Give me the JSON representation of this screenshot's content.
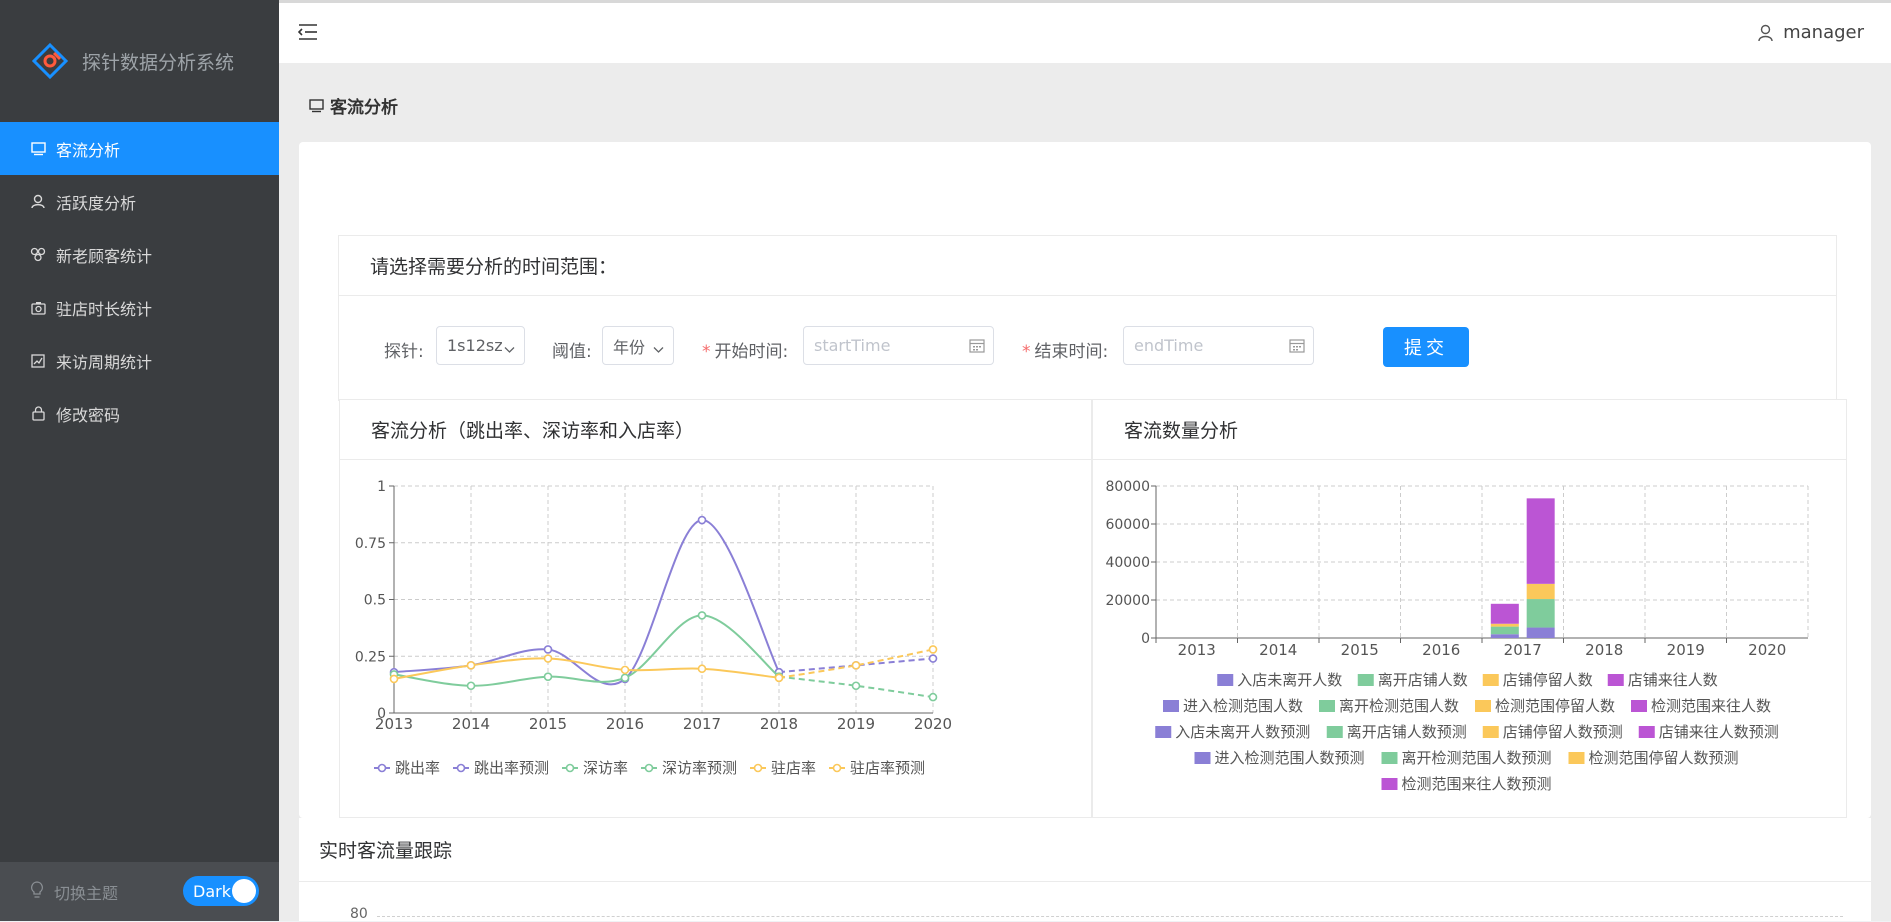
{
  "app": {
    "title": "探针数据分析系统"
  },
  "sidebar": {
    "items": [
      {
        "label": "客流分析",
        "icon": "monitor-icon",
        "active": true
      },
      {
        "label": "活跃度分析",
        "icon": "user-icon",
        "active": false
      },
      {
        "label": "新老顾客统计",
        "icon": "cluster-icon",
        "active": false
      },
      {
        "label": "驻店时长统计",
        "icon": "camera-icon",
        "active": false
      },
      {
        "label": "来访周期统计",
        "icon": "chart-icon",
        "active": false
      },
      {
        "label": "修改密码",
        "icon": "lock-icon",
        "active": false
      }
    ],
    "theme_label": "切换主题",
    "theme_switch": "Dark"
  },
  "header": {
    "username": "manager"
  },
  "breadcrumb": {
    "label": "客流分析"
  },
  "filter": {
    "title": "请选择需要分析的时间范围：",
    "probe_label": "探针:",
    "probe_value": "1s12sz",
    "threshold_label": "阈值:",
    "threshold_value": "年份",
    "start_label": "开始时间:",
    "start_placeholder": "startTime",
    "end_label": "结束时间:",
    "end_placeholder": "endTime",
    "submit_label": "提交",
    "required_mark": "*"
  },
  "colors": {
    "accent": "#1890ff",
    "purple": "#8a7fd6",
    "green": "#7fcc9c",
    "yellow": "#fbc85a",
    "magenta": "#bb55d4"
  },
  "chart_rates_title": "客流分析（跳出率、深访率和入店率）",
  "chart_counts_title": "客流数量分析",
  "realtime_title": "实时客流量跟踪",
  "realtime_axis_top": "80",
  "chart_data": [
    {
      "type": "line",
      "title": "客流分析（跳出率、深访率和入店率）",
      "categories": [
        "2013",
        "2014",
        "2015",
        "2016",
        "2017",
        "2018",
        "2019",
        "2020"
      ],
      "ylim": [
        0,
        1
      ],
      "yticks": [
        "0",
        "0.25",
        "0.5",
        "0.75",
        "1"
      ],
      "grid": true,
      "legend_position": "bottom",
      "series": [
        {
          "name": "跳出率",
          "color": "#8a7fd6",
          "style": "solid",
          "values": [
            0.18,
            0.21,
            0.28,
            0.15,
            0.85,
            0.18,
            null,
            null
          ]
        },
        {
          "name": "跳出率预测",
          "color": "#8a7fd6",
          "style": "dashed",
          "values": [
            null,
            null,
            null,
            null,
            null,
            0.18,
            0.21,
            0.24
          ]
        },
        {
          "name": "深访率",
          "color": "#7fcc9c",
          "style": "solid",
          "values": [
            0.17,
            0.12,
            0.16,
            0.155,
            0.43,
            0.16,
            null,
            null
          ]
        },
        {
          "name": "深访率预测",
          "color": "#7fcc9c",
          "style": "dashed",
          "values": [
            null,
            null,
            null,
            null,
            null,
            0.16,
            0.12,
            0.07
          ]
        },
        {
          "name": "驻店率",
          "color": "#fbc85a",
          "style": "solid",
          "values": [
            0.15,
            0.21,
            0.24,
            0.19,
            0.195,
            0.155,
            null,
            null
          ]
        },
        {
          "name": "驻店率预测",
          "color": "#fbc85a",
          "style": "dashed",
          "values": [
            null,
            null,
            null,
            null,
            null,
            0.155,
            0.21,
            0.28
          ]
        }
      ]
    },
    {
      "type": "bar",
      "stacked": true,
      "title": "客流数量分析",
      "categories": [
        "2013",
        "2014",
        "2015",
        "2016",
        "2017",
        "2018",
        "2019",
        "2020"
      ],
      "ylim": [
        0,
        80000
      ],
      "yticks": [
        "0",
        "20000",
        "40000",
        "60000",
        "80000"
      ],
      "grid": true,
      "legend_position": "bottom",
      "series": [
        {
          "name": "入店未离开人数",
          "color": "#8a7fd6",
          "stack": "store",
          "values": [
            0,
            0,
            0,
            0,
            null,
            0,
            0,
            0
          ]
        },
        {
          "name": "离开店铺人数",
          "color": "#7fcc9c",
          "stack": "store",
          "values": [
            0,
            0,
            0,
            0,
            null,
            0,
            0,
            0
          ]
        },
        {
          "name": "店铺停留人数",
          "color": "#fbc85a",
          "stack": "store",
          "values": [
            0,
            0,
            0,
            0,
            null,
            0,
            0,
            0
          ]
        },
        {
          "name": "店铺来往人数",
          "color": "#bb55d4",
          "stack": "store",
          "values": [
            0,
            0,
            0,
            0,
            null,
            0,
            0,
            0
          ]
        },
        {
          "name": "进入检测范围人数",
          "color": "#8a7fd6",
          "stack": "range",
          "values": [
            0,
            0,
            0,
            0,
            null,
            0,
            0,
            0
          ]
        },
        {
          "name": "离开检测范围人数",
          "color": "#7fcc9c",
          "stack": "range",
          "values": [
            0,
            0,
            0,
            0,
            null,
            0,
            0,
            0
          ]
        },
        {
          "name": "检测范围停留人数",
          "color": "#fbc85a",
          "stack": "range",
          "values": [
            0,
            0,
            0,
            0,
            null,
            0,
            0,
            0
          ]
        },
        {
          "name": "检测范围来往人数",
          "color": "#bb55d4",
          "stack": "range",
          "values": [
            0,
            0,
            0,
            0,
            null,
            0,
            0,
            0
          ]
        },
        {
          "name": "入店未离开人数预测",
          "color": "#8a7fd6",
          "stack": "store",
          "values": [
            0,
            0,
            0,
            0,
            2000,
            0,
            0,
            0
          ]
        },
        {
          "name": "离开店铺人数预测",
          "color": "#7fcc9c",
          "stack": "store",
          "values": [
            0,
            0,
            0,
            0,
            4000,
            0,
            0,
            0
          ]
        },
        {
          "name": "店铺停留人数预测",
          "color": "#fbc85a",
          "stack": "store",
          "values": [
            0,
            0,
            0,
            0,
            1500,
            0,
            0,
            0
          ]
        },
        {
          "name": "店铺来往人数预测",
          "color": "#bb55d4",
          "stack": "store",
          "values": [
            0,
            0,
            0,
            0,
            10500,
            0,
            0,
            0
          ]
        },
        {
          "name": "进入检测范围人数预测",
          "color": "#8a7fd6",
          "stack": "range",
          "values": [
            0,
            0,
            0,
            0,
            5500,
            0,
            0,
            0
          ]
        },
        {
          "name": "离开检测范围人数预测",
          "color": "#7fcc9c",
          "stack": "range",
          "values": [
            0,
            0,
            0,
            0,
            15000,
            0,
            0,
            0
          ]
        },
        {
          "name": "检测范围停留人数预测",
          "color": "#fbc85a",
          "stack": "range",
          "values": [
            0,
            0,
            0,
            0,
            8000,
            0,
            0,
            0
          ]
        },
        {
          "name": "检测范围来往人数预测",
          "color": "#bb55d4",
          "stack": "range",
          "values": [
            0,
            0,
            0,
            0,
            45000,
            0,
            0,
            0
          ]
        }
      ]
    }
  ]
}
